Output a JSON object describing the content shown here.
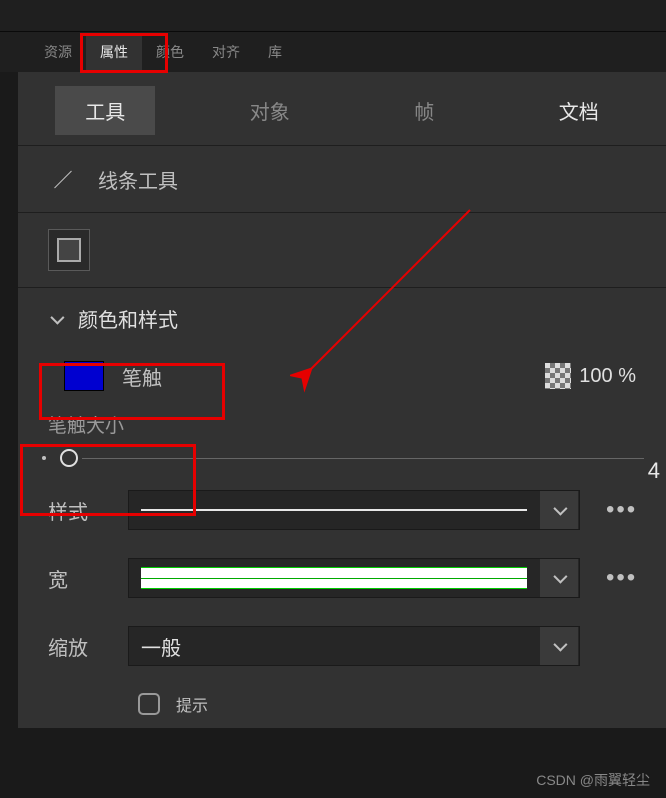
{
  "panelTabs": {
    "resources": "资源",
    "properties": "属性",
    "color": "颜色",
    "align": "对齐",
    "library": "库"
  },
  "subTabs": {
    "tool": "工具",
    "object": "对象",
    "frame": "帧",
    "document": "文档"
  },
  "tool": {
    "label": "线条工具"
  },
  "section": {
    "colorStyle": "颜色和样式"
  },
  "stroke": {
    "label": "笔触",
    "opacity": "100 %",
    "sizeLabel": "笔触大小",
    "sizeValue": "4"
  },
  "form": {
    "styleLabel": "样式",
    "widthLabel": "宽",
    "scaleLabel": "缩放",
    "scaleValue": "一般",
    "hintLabel": "提示"
  },
  "watermark": "CSDN @雨翼轻尘"
}
